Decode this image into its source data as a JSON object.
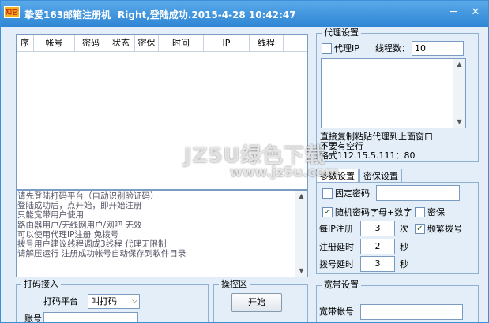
{
  "titlebar": {
    "icon_text": "知它",
    "title": "挚爱163邮箱注册机",
    "status": "Right,登陆成功.2015-4-28 10:42:47",
    "min_symbol": "─",
    "close_symbol": "✕"
  },
  "grid": {
    "columns": [
      "序",
      "帐号",
      "密码",
      "状态",
      "密保",
      "时间",
      "IP",
      "线程"
    ]
  },
  "log": {
    "lines": [
      "请先登陆打码平台（自动识别验证码）",
      "登陆成功后，点开始，即开始注册",
      "只能宽带用户使用",
      "路由器用户/无线网用户/网吧 无效",
      "可以使用代理IP注册 免拨号",
      "拨号用户建议线程调成3线程 代理无限制",
      "请解压运行 注册成功帐号自动保存到软件目录"
    ]
  },
  "captcha_group": {
    "title": "打码接入",
    "platform_label": "打码平台",
    "platform_value": "叫打码",
    "account_label": "账号"
  },
  "control_group": {
    "title": "操控区",
    "start_label": "开始"
  },
  "proxy_group": {
    "title": "代理设置",
    "use_proxy_label": "代理IP",
    "threads_label": "线程数：",
    "threads_value": "10",
    "hint_1": "直接复制粘贴代理到上面窗口",
    "hint_2": "不要有空行",
    "hint_3": "格式112.15.5.111：80"
  },
  "tabs": {
    "params": "参数设置",
    "security": "密保设置"
  },
  "params": {
    "fixed_password_label": "固定密码",
    "random_password_label": "随机密码字母+数字",
    "security_label": "密保",
    "per_ip_label": "每IP注册",
    "per_ip_value": "3",
    "per_ip_unit": "次",
    "frequent_dial_label": "频繁拨号",
    "reg_delay_label": "注册延时",
    "reg_delay_value": "2",
    "reg_delay_unit": "秒",
    "dial_delay_label": "拨号延时",
    "dial_delay_value": "3",
    "dial_delay_unit": "秒",
    "checked_mark": "✓"
  },
  "broadband_group": {
    "title": "宽带设置",
    "account_label": "宽带帐号"
  },
  "watermark": {
    "line1": "JZ5U绿色下载",
    "line2": "www.jz5u.com"
  },
  "scroll": {
    "up": "▲",
    "down": "▼"
  }
}
